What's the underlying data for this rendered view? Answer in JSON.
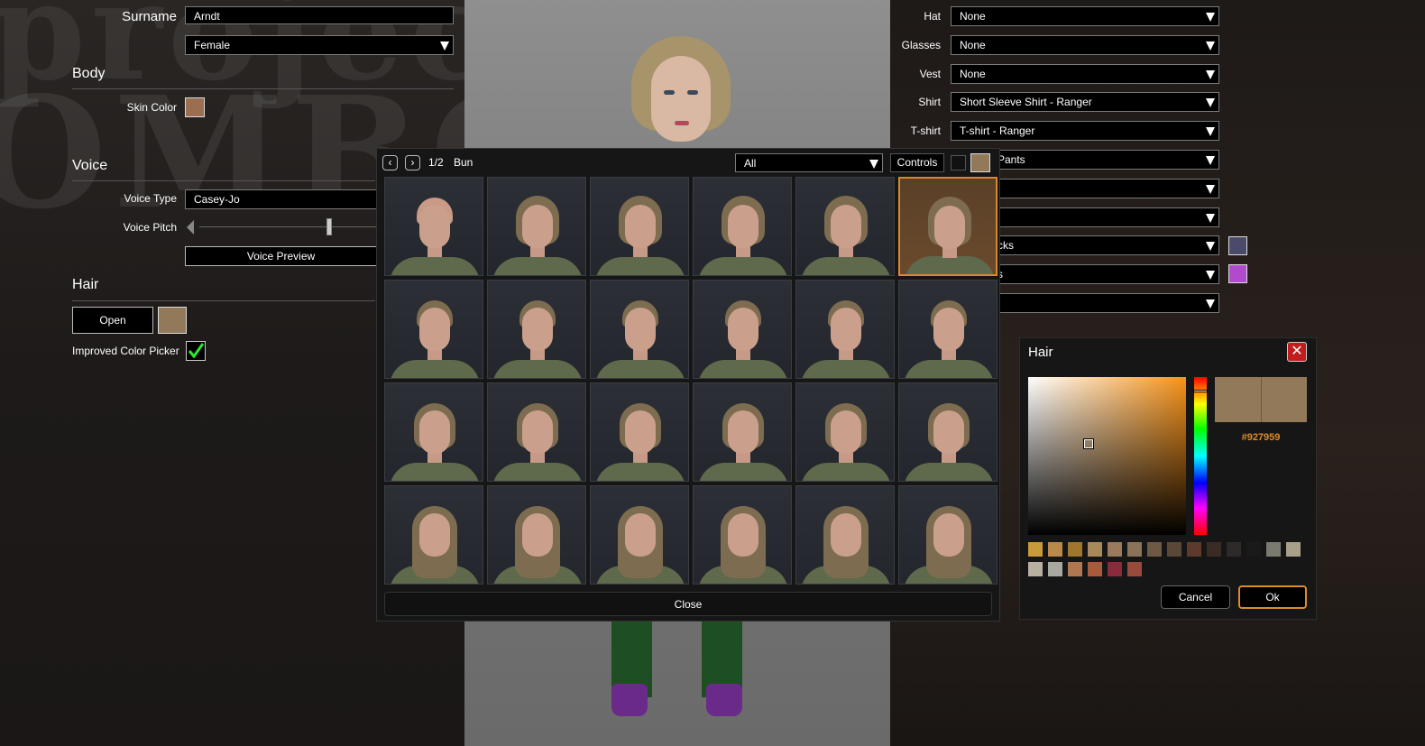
{
  "left": {
    "surname_label": "Surname",
    "surname_value": "Arndt",
    "gender_value": "Female",
    "body_header": "Body",
    "skin_color_label": "Skin Color",
    "skin_color": "#9a6e4e",
    "voice_header": "Voice",
    "voice_type_label": "Voice Type",
    "voice_type_value": "Casey-Jo",
    "voice_pitch_label": "Voice Pitch",
    "voice_pitch_level": 0.74,
    "voice_preview_label": "Voice Preview",
    "hair_header": "Hair",
    "hair_open_label": "Open",
    "hair_color": "#927959",
    "improved_color_label": "Improved Color Picker",
    "improved_color_checked": true
  },
  "right": {
    "rows": [
      {
        "label": "Hat",
        "value": "None"
      },
      {
        "label": "Glasses",
        "value": "None"
      },
      {
        "label": "Vest",
        "value": "None"
      },
      {
        "label": "Shirt",
        "value": "Short Sleeve Shirt - Ranger"
      },
      {
        "label": "T-shirt",
        "value": "T-shirt - Ranger"
      },
      {
        "label": "",
        "value": "Pants"
      },
      {
        "label": "",
        "value": ""
      },
      {
        "label": "",
        "value": ""
      },
      {
        "label": "",
        "value": "cks"
      },
      {
        "label": "",
        "value": "s"
      },
      {
        "label": "",
        "value": ""
      }
    ],
    "swatch_socks": "#4a4a6a",
    "swatch_shoes": "#b04ccc"
  },
  "picker": {
    "page": "1/2",
    "style_name": "Bun",
    "filter_value": "All",
    "controls_label": "Controls",
    "close_label": "Close",
    "selected_index": 5
  },
  "color_picker": {
    "title": "Hair",
    "hex": "#927959",
    "cancel_label": "Cancel",
    "ok_label": "Ok",
    "palette": [
      "#c89a3a",
      "#b8894a",
      "#a0762c",
      "#a88a5a",
      "#9a7a5a",
      "#8a7358",
      "#6e5a44",
      "#5a4836",
      "#5e3a2a",
      "#3a2c24",
      "#2e2a2a",
      "#1a1a1a",
      "#7a7a70",
      "#a8a088",
      "#b8b0a0",
      "#a8a8a0",
      "#b07850",
      "#a85a3a",
      "#8a2a3a",
      "#9a4a3a"
    ]
  }
}
